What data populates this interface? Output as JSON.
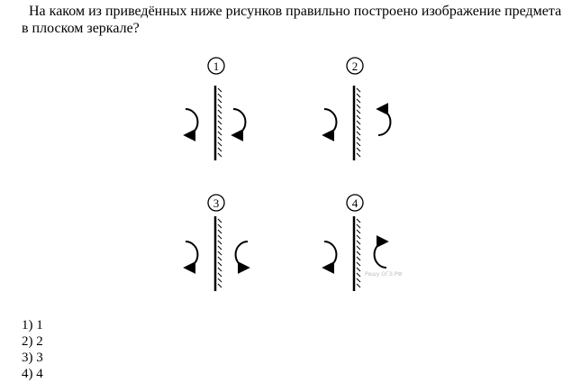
{
  "question": {
    "text": "На каком из приведённых ниже рисунков правильно построено изображение предмета в плоском зеркале?"
  },
  "figures": [
    {
      "number": "1"
    },
    {
      "number": "2"
    },
    {
      "number": "3"
    },
    {
      "number": "4"
    }
  ],
  "answers": [
    {
      "label": "1) 1"
    },
    {
      "label": "2) 2"
    },
    {
      "label": "3) 3"
    },
    {
      "label": "4) 4"
    }
  ],
  "watermark": "Решу ОГЭ.РФ"
}
